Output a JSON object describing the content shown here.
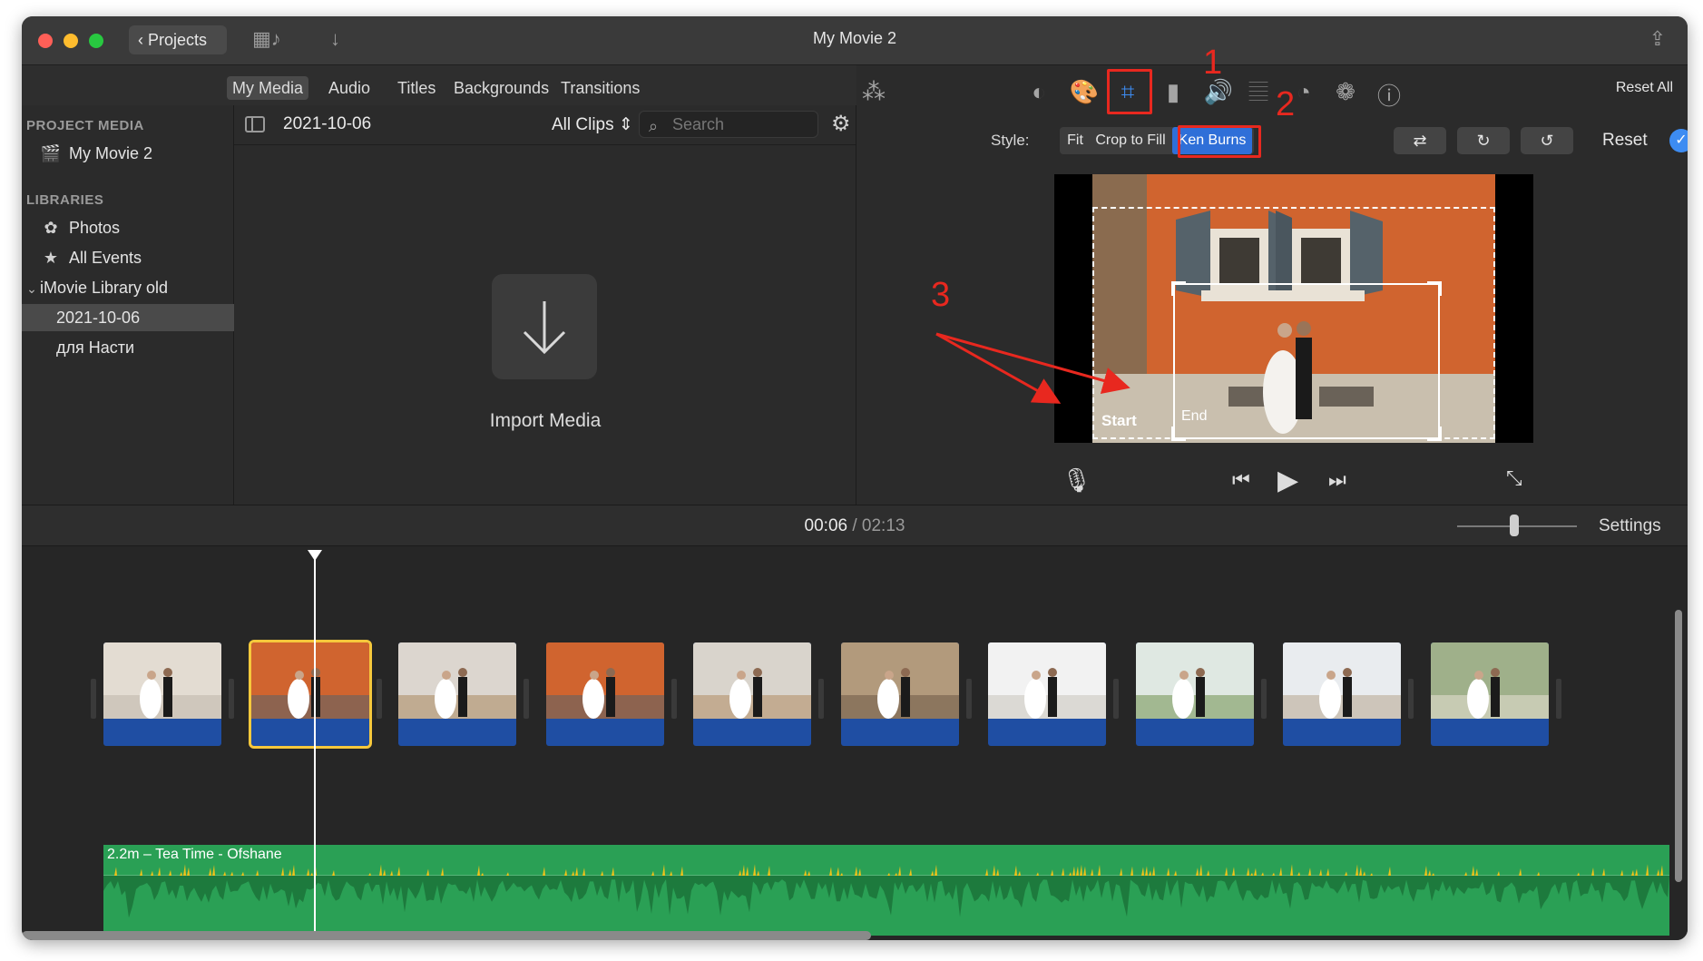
{
  "window": {
    "title": "My Movie 2",
    "back_label": "Projects"
  },
  "browser_tabs": [
    "My Media",
    "Audio",
    "Titles",
    "Backgrounds",
    "Transitions"
  ],
  "sidebar": {
    "project_media_heading": "PROJECT MEDIA",
    "project_item": "My Movie 2",
    "libraries_heading": "LIBRARIES",
    "items": [
      {
        "label": "Photos",
        "icon": "photos-icon"
      },
      {
        "label": "All Events",
        "icon": "star-icon"
      },
      {
        "label": "iMovie Library old",
        "icon": "chevron-down-icon"
      },
      {
        "label": "2021-10-06",
        "selected": true
      },
      {
        "label": "для Насти"
      }
    ]
  },
  "browser": {
    "date": "2021-10-06",
    "filter": "All Clips",
    "search_placeholder": "Search",
    "import_label": "Import Media"
  },
  "viewer": {
    "reset_all": "Reset All",
    "style_label": "Style:",
    "style_options": [
      "Fit",
      "Crop to Fill",
      "Ken Burns"
    ],
    "selected_style": "Ken Burns",
    "reset_label": "Reset",
    "start_label": "Start",
    "end_label": "End",
    "annotations": [
      "1",
      "2",
      "3"
    ]
  },
  "timebar": {
    "current": "00:06",
    "separator": "/",
    "total": "02:13",
    "settings": "Settings"
  },
  "timeline": {
    "clip_count": 10,
    "selected_clip": 2,
    "audio_label": "2.2m – Tea Time - Ofshane"
  },
  "colors": {
    "accent": "#3d8cf2",
    "annotation": "#e8281f",
    "audio": "#2aa055",
    "clip_bar": "#1f4ea3",
    "selected_clip": "#f6c83c"
  }
}
